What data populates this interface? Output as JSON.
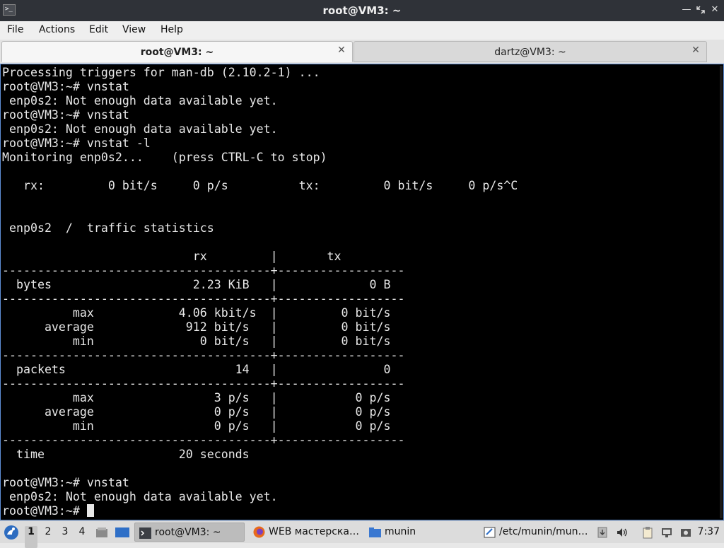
{
  "window": {
    "title": "root@VM3: ~",
    "icon_name": "terminal-icon"
  },
  "menu": [
    "File",
    "Actions",
    "Edit",
    "View",
    "Help"
  ],
  "tabs": [
    {
      "label": "root@VM3: ~",
      "active": true
    },
    {
      "label": "dartz@VM3: ~",
      "active": false
    }
  ],
  "terminal": {
    "lines": [
      "Processing triggers for man-db (2.10.2-1) ...",
      "root@VM3:~# vnstat",
      " enp0s2: Not enough data available yet.",
      "root@VM3:~# vnstat",
      " enp0s2: Not enough data available yet.",
      "root@VM3:~# vnstat -l",
      "Monitoring enp0s2...    (press CTRL-C to stop)",
      "",
      "   rx:         0 bit/s     0 p/s          tx:         0 bit/s     0 p/s^C",
      "",
      "",
      " enp0s2  /  traffic statistics",
      "",
      "                           rx         |       tx",
      "--------------------------------------+------------------",
      "  bytes                    2.23 KiB   |             0 B",
      "--------------------------------------+------------------",
      "          max            4.06 kbit/s  |         0 bit/s",
      "      average             912 bit/s   |         0 bit/s",
      "          min               0 bit/s   |         0 bit/s",
      "--------------------------------------+------------------",
      "  packets                        14   |               0",
      "--------------------------------------+------------------",
      "          max                 3 p/s   |           0 p/s",
      "      average                 0 p/s   |           0 p/s",
      "          min                 0 p/s   |           0 p/s",
      "--------------------------------------+------------------",
      "  time                   20 seconds",
      "",
      "root@VM3:~# vnstat",
      " enp0s2: Not enough data available yet."
    ],
    "prompt": "root@VM3:~# "
  },
  "taskbar": {
    "workspaces": [
      "1",
      "2",
      "3",
      "4"
    ],
    "tasks": [
      {
        "label": "root@VM3: ~",
        "icon": "terminal-icon",
        "active": true
      },
      {
        "label": "WEB мастерска…",
        "icon": "firefox-icon",
        "active": false
      },
      {
        "label": "munin",
        "icon": "folder-icon",
        "active": false
      },
      {
        "label": "/etc/munin/mun…",
        "icon": "text-editor-icon",
        "active": false
      }
    ],
    "clock": "7:37"
  },
  "colors": {
    "titlebar": "#2f3238",
    "terminal_bg": "#000000",
    "terminal_fg": "#e8e8e8",
    "terminal_border": "#5e8fd6",
    "taskbar": "#dcdcdc"
  }
}
